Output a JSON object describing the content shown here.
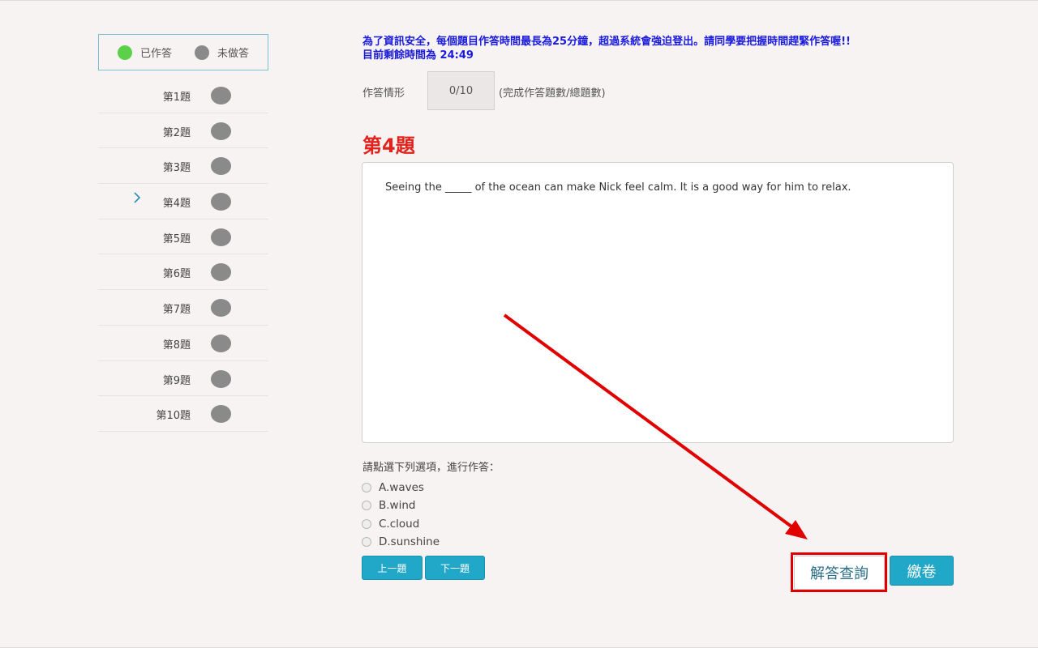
{
  "legend": {
    "answered_label": "已作答",
    "unanswered_label": "未做答"
  },
  "sidebar": {
    "current_index": 3,
    "items": [
      {
        "label": "第1題"
      },
      {
        "label": "第2題"
      },
      {
        "label": "第3題"
      },
      {
        "label": "第4題"
      },
      {
        "label": "第5題"
      },
      {
        "label": "第6題"
      },
      {
        "label": "第7題"
      },
      {
        "label": "第8題"
      },
      {
        "label": "第9題"
      },
      {
        "label": "第10題"
      }
    ]
  },
  "notice": {
    "line1": "為了資訊安全，每個題目作答時間最長為25分鐘，超過系統會強迫登出。請同學要把握時間趕緊作答喔!!",
    "line2": "目前剩餘時間為 24:49"
  },
  "status": {
    "label": "作答情形",
    "value": "0/10",
    "note": "(完成作答題數/總題數)"
  },
  "question": {
    "title": "第4題",
    "text": "Seeing the _____ of the ocean can make Nick feel calm. It is a good way for him to relax."
  },
  "options": {
    "prompt": "請點選下列選項，進行作答：",
    "items": [
      {
        "label": "A.waves"
      },
      {
        "label": "B.wind"
      },
      {
        "label": "C.cloud"
      },
      {
        "label": "D.sunshine"
      }
    ]
  },
  "buttons": {
    "prev": "上一題",
    "next": "下一題",
    "answer_query": "解答查詢",
    "submit": "繳卷"
  },
  "colors": {
    "accent": "#21a7c8",
    "title_red": "#e0241d",
    "notice_blue": "#1a1adb",
    "answered_green": "#5bd14a",
    "unanswered_grey": "#8a8a8a",
    "annotation_red": "#e00000"
  }
}
